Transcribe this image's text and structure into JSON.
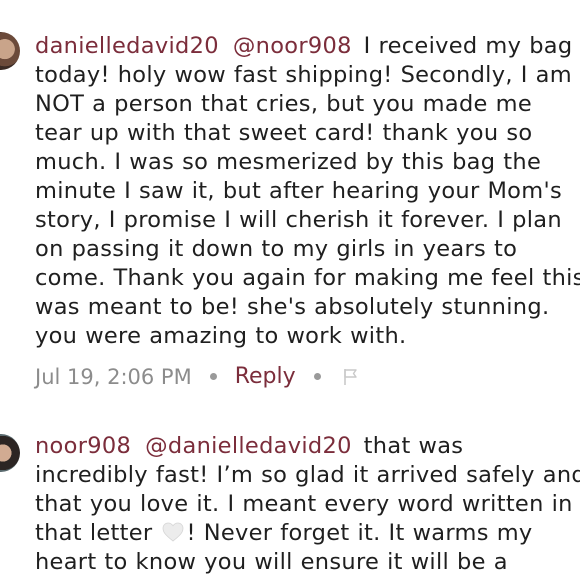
{
  "comments": [
    {
      "username": "danielledavid20",
      "mention": "@noor908",
      "lines": [
        "I received my bag",
        "today! holy wow fast shipping! Secondly, I am",
        "NOT a person that cries, but you made me",
        "tear up with that sweet card! thank you so",
        "much. I was so mesmerized by this bag the",
        "minute I saw it, but after hearing your Mom's",
        "story, I promise I will cherish it forever. I plan",
        "on passing it down to my girls in years to",
        "come. Thank you again for making me feel this",
        "was meant to be! she's absolutely stunning.",
        "you were amazing to work with."
      ],
      "timestamp": "Jul 19, 2:06 PM",
      "reply_label": "Reply"
    },
    {
      "username": "noor908",
      "mention": "@danielledavid20",
      "lines": [
        "that was",
        "incredibly fast! I’m so glad it arrived safely and",
        "that you love it. I meant every word written in",
        "that letter",
        "! Never forget it. It warms my",
        "heart to know you will ensure it will be a"
      ],
      "heart_icon": "white-heart-icon"
    }
  ],
  "colors": {
    "username": "#7b2d3b",
    "meta": "#8c8c8c",
    "text": "#1f1f1f"
  }
}
